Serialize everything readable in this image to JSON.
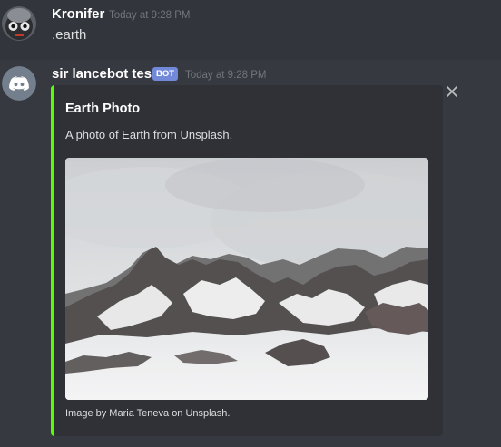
{
  "messages": [
    {
      "username": "Kronifer",
      "timestamp": "Today at 9:28 PM",
      "content": ".earth",
      "avatar_icon": "robot-avatar-icon"
    },
    {
      "username": "sir lancebot test",
      "badge": "BOT",
      "timestamp": "Today at 9:28 PM",
      "avatar_icon": "discord-logo-icon",
      "embed": {
        "accent_color": "#55ff00",
        "title": "Earth Photo",
        "description": "A photo of Earth from Unsplash.",
        "image_icon": "snowy-mountain-photo",
        "footer": "Image by Maria Teneva on Unsplash."
      }
    }
  ],
  "colors": {
    "background": "#36393f",
    "badge": "#7289da",
    "embed_bg": "#2f3136",
    "username": "#ffffff",
    "timestamp": "#72767d"
  },
  "icons": {
    "dismiss": "close-icon"
  }
}
